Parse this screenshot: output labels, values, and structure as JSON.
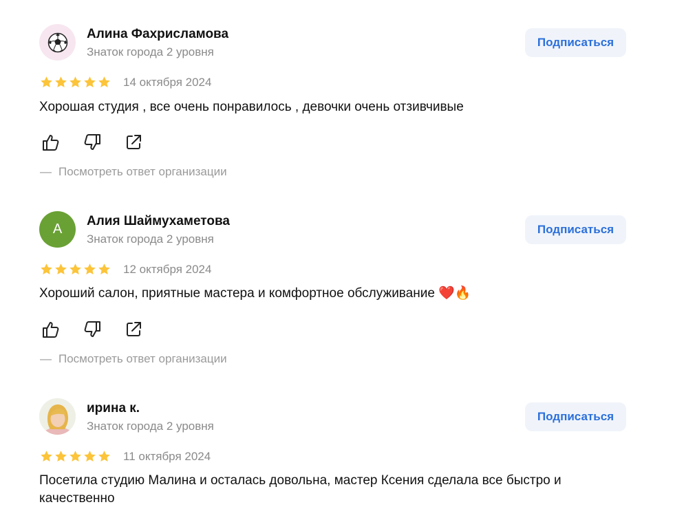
{
  "reviews": [
    {
      "author": "Алина Фахрисламова",
      "level": "Знаток города 2 уровня",
      "subscribe_label": "Подписаться",
      "date": "14 октября 2024",
      "rating": 5,
      "text": "Хорошая студия , все очень понравилось , девочки очень отзивчивые",
      "avatar_type": "soccer-ball-icon",
      "org_reply_label": "Посмотреть ответ организации"
    },
    {
      "author": "Алия Шаймухаметова",
      "level": "Знаток города 2 уровня",
      "subscribe_label": "Подписаться",
      "date": "12 октября 2024",
      "rating": 5,
      "text": "Хороший салон, приятные мастера и комфортное обслуживание ❤️🔥",
      "avatar_letter": "А",
      "org_reply_label": "Посмотреть ответ организации"
    },
    {
      "author": "ирина к.",
      "level": "Знаток города 2 уровня",
      "subscribe_label": "Подписаться",
      "date": "11 октября 2024",
      "rating": 5,
      "text": "Посетила студию Малина и осталась довольна, мастер Ксения сделала все быстро и качественно",
      "avatar_type": "photo",
      "org_reply_label": ""
    }
  ],
  "org_reply_dash": "—",
  "colors": {
    "accent": "#2b6fdb",
    "star": "#fcc43a",
    "muted": "#8a8a8a",
    "button_bg": "#f0f4fa",
    "avatar_green": "#6aa135"
  }
}
